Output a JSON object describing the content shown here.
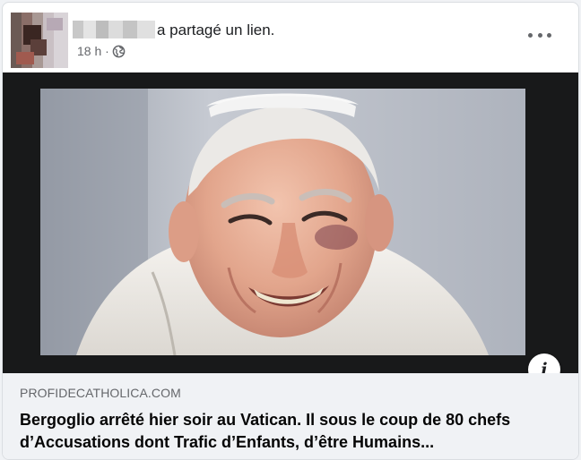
{
  "post": {
    "action_text": "a partagé un lien.",
    "time": "18 h ·",
    "privacy_icon": "globe-icon",
    "more_icon": "more-options-icon"
  },
  "link": {
    "domain": "PROFIDECATHOLICA.COM",
    "title": "Bergoglio arrêté hier soir au Vatican. Il sous le coup de 80 chefs d’Accusations dont Trafic d’Enfants, d’être Humains...",
    "info_icon_glyph": "i"
  },
  "colors": {
    "secondary_text": "#65676b",
    "link_box_bg": "#f0f2f5",
    "image_bg": "#18191a"
  }
}
